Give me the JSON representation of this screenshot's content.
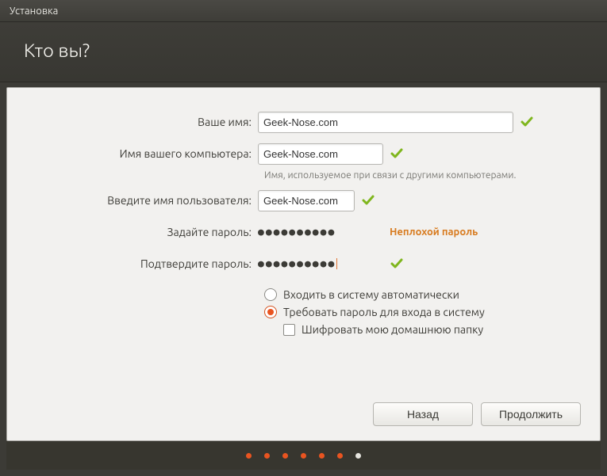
{
  "window_title": "Установка",
  "page_title": "Кто вы?",
  "labels": {
    "name": "Ваше имя:",
    "computer": "Имя вашего компьютера:",
    "computer_hint": "Имя, используемое при связи с другими компьютерами.",
    "username": "Введите имя пользователя:",
    "password": "Задайте пароль:",
    "confirm": "Подтвердите пароль:"
  },
  "values": {
    "name": "Geek-Nose.com",
    "computer": "Geek-Nose.com",
    "username": "Geek-Nose.com",
    "password_mask": "●●●●●●●●●●",
    "confirm_mask": "●●●●●●●●●●"
  },
  "password_strength": "Неплохой пароль",
  "options": {
    "auto_login": "Входить в систему автоматически",
    "require_password": "Требовать пароль для входа в систему",
    "encrypt_home": "Шифровать мою домашнюю папку",
    "selected": "require_password",
    "encrypt_checked": false
  },
  "buttons": {
    "back": "Назад",
    "continue": "Продолжить"
  },
  "pager": {
    "total": 7,
    "current": 6
  },
  "colors": {
    "accent": "#e95420",
    "strength": "#d87b1f"
  }
}
